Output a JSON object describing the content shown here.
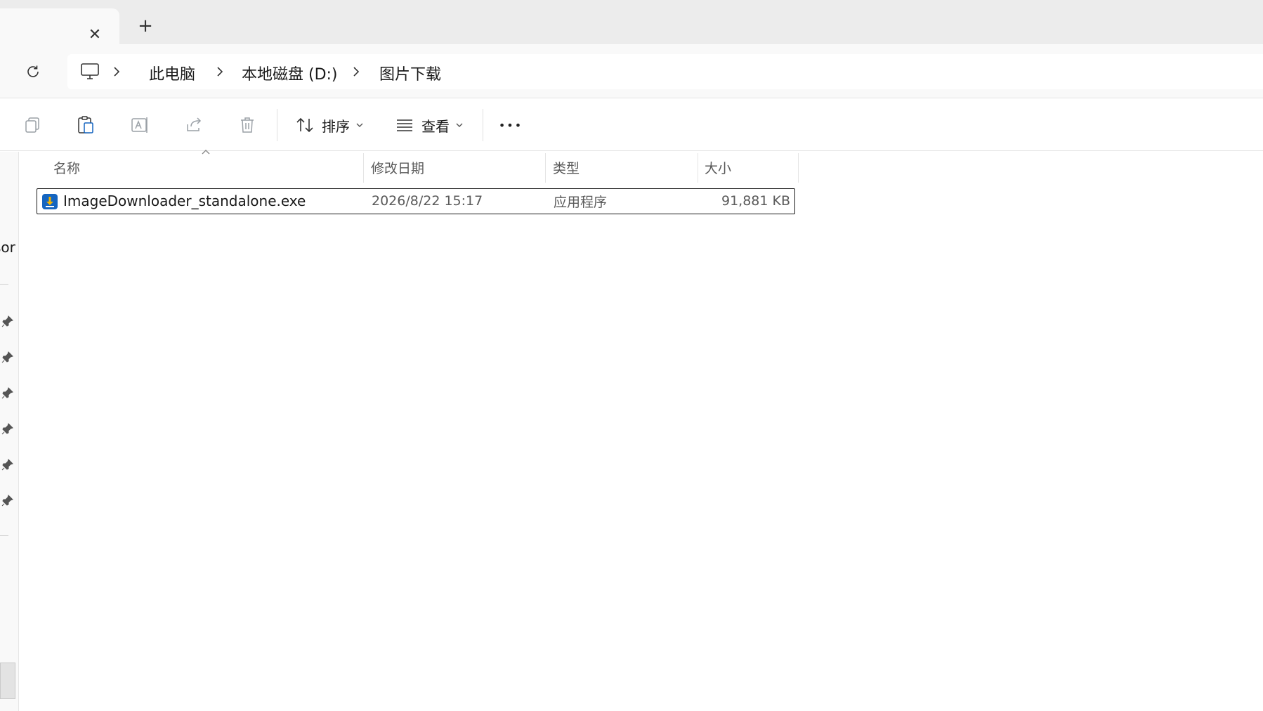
{
  "tabs": {
    "close_glyph": "✕",
    "new_tab_glyph": "+"
  },
  "breadcrumb": [
    {
      "label": "此电脑"
    },
    {
      "label": "本地磁盘 (D:)"
    },
    {
      "label": "图片下载"
    }
  ],
  "toolbar": {
    "sort_label": "排序",
    "view_label": "查看",
    "more_glyph": "•••"
  },
  "navpane": {
    "partial_text": "sor"
  },
  "columns": {
    "name": "名称",
    "modified": "修改日期",
    "type": "类型",
    "size": "大小"
  },
  "files": [
    {
      "name": "ImageDownloader_standalone.exe",
      "modified": "2026/8/22 15:17",
      "type": "应用程序",
      "size": "91,881 KB"
    }
  ],
  "colors": {
    "icon_blue": "#1565c0",
    "icon_gold": "#f5b400",
    "muted": "#9aa0a6"
  }
}
